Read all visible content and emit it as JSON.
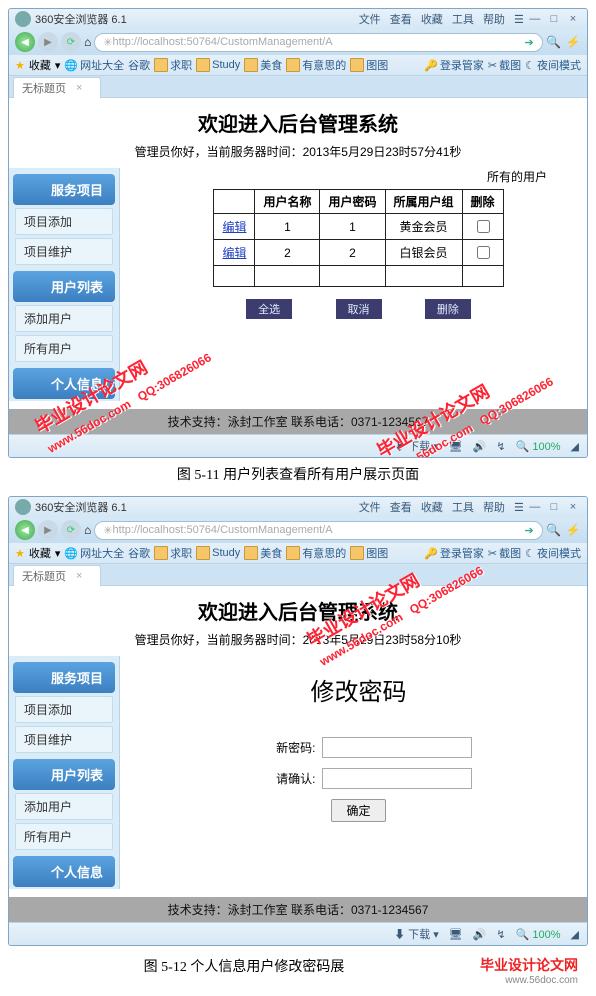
{
  "browser": {
    "title": "360安全浏览器 6.1",
    "menus": [
      "文件",
      "查看",
      "收藏",
      "工具",
      "帮助"
    ],
    "url": "http://localhost:50764/CustomManagement/A",
    "fav_label": "收藏",
    "bookmarks": [
      "网址大全",
      "谷歌",
      "求职",
      "Study",
      "美食",
      "有意思的",
      "图图"
    ],
    "extras": [
      "登录管家",
      "截图",
      "夜间模式"
    ],
    "tab": "无标题页",
    "status": {
      "download": "下载",
      "zoom": "100%"
    }
  },
  "page1": {
    "title": "欢迎进入后台管理系统",
    "greet": "管理员你好，当前服务器时间：2013年5月29日23时57分41秒",
    "all_users": "所有的用户",
    "cols": [
      "用户名称",
      "用户密码",
      "所属用户组",
      "删除"
    ],
    "rows": [
      {
        "edit": "编辑",
        "name": "1",
        "pwd": "1",
        "group": "黄金会员"
      },
      {
        "edit": "编辑",
        "name": "2",
        "pwd": "2",
        "group": "白银会员"
      }
    ],
    "buttons": [
      "全选",
      "取消",
      "删除"
    ],
    "footer": "技术支持：泳封工作室 联系电话：0371-1234567"
  },
  "page2": {
    "title": "欢迎进入后台管理系统",
    "greet": "管理员你好，当前服务器时间：2013年5月29日23时58分10秒",
    "pwd_title": "修改密码",
    "labels": {
      "newpwd": "新密码:",
      "confirm": "请确认:",
      "ok": "确定"
    },
    "footer": "技术支持：泳封工作室 联系电话：0371-1234567"
  },
  "sidebar": {
    "groups": [
      {
        "head": "服务项目",
        "items": [
          "项目添加",
          "项目维护"
        ]
      },
      {
        "head": "用户列表",
        "items": [
          "添加用户",
          "所有用户"
        ]
      },
      {
        "head": "个人信息",
        "items": []
      }
    ]
  },
  "captions": {
    "c1": "图 5-11 用户列表查看所有用户展示页面",
    "c2": "图 5-12 个人信息用户修改密码展"
  },
  "watermark": {
    "site": "毕业设计论文网",
    "url": "www.56doc.com",
    "qq": "QQ:306826066"
  }
}
